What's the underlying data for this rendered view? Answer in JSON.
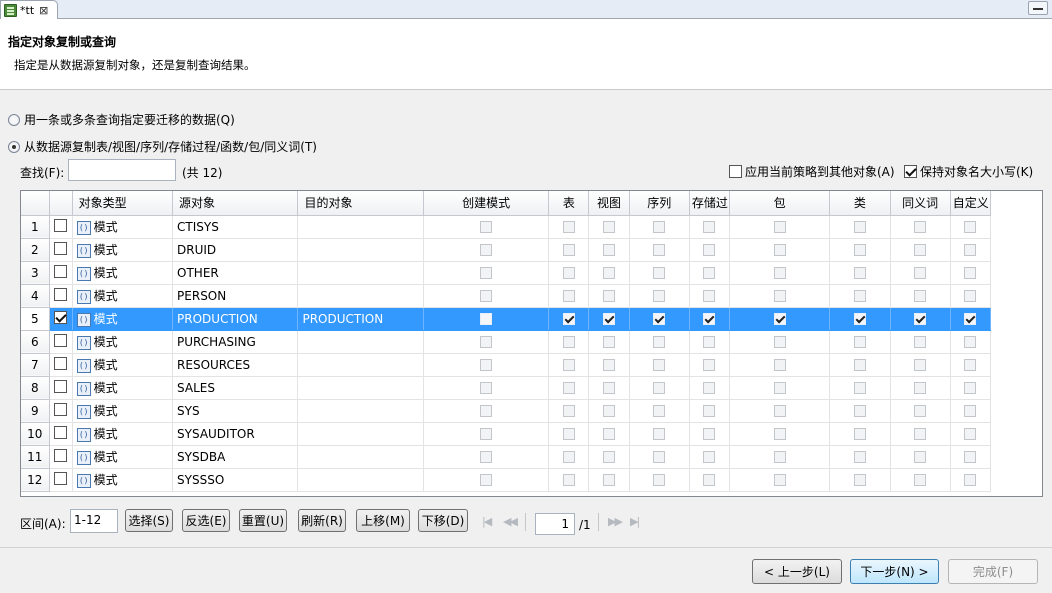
{
  "tab": {
    "title": "*tt",
    "close": "⊠"
  },
  "header": {
    "title": "指定对象复制或查询",
    "description": "指定是从数据源复制对象，还是复制查询结果。"
  },
  "options": {
    "query_option": "用一条或多条查询指定要迁移的数据(Q)",
    "copy_option": "从数据源复制表/视图/序列/存储过程/函数/包/同义词(T)",
    "selected": "copy_option"
  },
  "search": {
    "label": "查找(F):",
    "value": "",
    "count": "(共 12)"
  },
  "checks": {
    "apply_policy": {
      "label": "应用当前策略到其他对象(A)",
      "checked": false
    },
    "keep_case": {
      "label": "保持对象名大小写(K)",
      "checked": true
    }
  },
  "table": {
    "columns": [
      "对象类型",
      "源对象",
      "目的对象",
      "创建模式",
      "表",
      "视图",
      "序列",
      "存储过",
      "包",
      "类",
      "同义词",
      "自定义"
    ],
    "rows": [
      {
        "num": "1",
        "type": "模式",
        "source": "CTISYS",
        "target": "",
        "checked": false
      },
      {
        "num": "2",
        "type": "模式",
        "source": "DRUID",
        "target": "",
        "checked": false
      },
      {
        "num": "3",
        "type": "模式",
        "source": "OTHER",
        "target": "",
        "checked": false
      },
      {
        "num": "4",
        "type": "模式",
        "source": "PERSON",
        "target": "",
        "checked": false
      },
      {
        "num": "5",
        "type": "模式",
        "source": "PRODUCTION",
        "target": "PRODUCTION",
        "checked": true
      },
      {
        "num": "6",
        "type": "模式",
        "source": "PURCHASING",
        "target": "",
        "checked": false
      },
      {
        "num": "7",
        "type": "模式",
        "source": "RESOURCES",
        "target": "",
        "checked": false
      },
      {
        "num": "8",
        "type": "模式",
        "source": "SALES",
        "target": "",
        "checked": false
      },
      {
        "num": "9",
        "type": "模式",
        "source": "SYS",
        "target": "",
        "checked": false
      },
      {
        "num": "10",
        "type": "模式",
        "source": "SYSAUDITOR",
        "target": "",
        "checked": false
      },
      {
        "num": "11",
        "type": "模式",
        "source": "SYSDBA",
        "target": "",
        "checked": false
      },
      {
        "num": "12",
        "type": "模式",
        "source": "SYSSSO",
        "target": "",
        "checked": false
      }
    ],
    "selected_row": "5"
  },
  "toolbar": {
    "range_label": "区间(A):",
    "range_value": "1-12",
    "select": "选择(S)",
    "invert": "反选(E)",
    "reset": "重置(U)",
    "refresh": "刷新(R)",
    "move_up": "上移(M)",
    "move_down": "下移(D)",
    "page": "1",
    "page_total": "/1"
  },
  "footer": {
    "back": "< 上一步(L)",
    "next": "下一步(N) >",
    "finish": "完成(F)"
  },
  "colors": {
    "selection": "#3399ff",
    "primary_button": "#bee6fd"
  }
}
